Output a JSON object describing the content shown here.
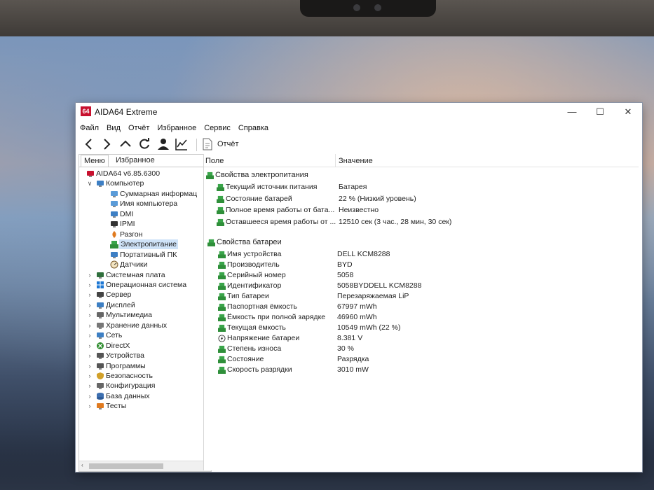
{
  "window": {
    "logo_text": "64",
    "title": "AIDA64 Extreme",
    "minimize": "—",
    "maximize": "☐",
    "close": "✕"
  },
  "menu": [
    "Файл",
    "Вид",
    "Отчёт",
    "Избранное",
    "Сервис",
    "Справка"
  ],
  "toolbar": {
    "icons": [
      "back-icon",
      "forward-icon",
      "up-icon",
      "refresh-icon",
      "user-icon",
      "chart-icon"
    ],
    "report_label": "Отчёт"
  },
  "left_tabs": {
    "menu": "Меню",
    "favorites": "Избранное"
  },
  "tree": [
    {
      "label": "AIDA64 v6.85.6300",
      "level": 0,
      "expander": "",
      "icon": "aida64-icon"
    },
    {
      "label": "Компьютер",
      "level": 1,
      "expander": "∨",
      "icon": "computer-icon"
    },
    {
      "label": "Суммарная информац",
      "level": 2,
      "expander": "",
      "icon": "summary-icon"
    },
    {
      "label": "Имя компьютера",
      "level": 2,
      "expander": "",
      "icon": "computer-name-icon"
    },
    {
      "label": "DMI",
      "level": 2,
      "expander": "",
      "icon": "dmi-icon"
    },
    {
      "label": "IPMI",
      "level": 2,
      "expander": "",
      "icon": "ipmi-icon"
    },
    {
      "label": "Разгон",
      "level": 2,
      "expander": "",
      "icon": "overclock-icon"
    },
    {
      "label": "Электропитание",
      "level": 2,
      "expander": "",
      "icon": "power-icon",
      "selected": true
    },
    {
      "label": "Портативный ПК",
      "level": 2,
      "expander": "",
      "icon": "laptop-icon"
    },
    {
      "label": "Датчики",
      "level": 2,
      "expander": "",
      "icon": "sensor-icon"
    },
    {
      "label": "Системная плата",
      "level": 1,
      "expander": "›",
      "icon": "motherboard-icon"
    },
    {
      "label": "Операционная система",
      "level": 1,
      "expander": "›",
      "icon": "windows-icon"
    },
    {
      "label": "Сервер",
      "level": 1,
      "expander": "›",
      "icon": "server-icon"
    },
    {
      "label": "Дисплей",
      "level": 1,
      "expander": "›",
      "icon": "display-icon"
    },
    {
      "label": "Мультимедиа",
      "level": 1,
      "expander": "›",
      "icon": "multimedia-icon"
    },
    {
      "label": "Хранение данных",
      "level": 1,
      "expander": "›",
      "icon": "storage-icon"
    },
    {
      "label": "Сеть",
      "level": 1,
      "expander": "›",
      "icon": "network-icon"
    },
    {
      "label": "DirectX",
      "level": 1,
      "expander": "›",
      "icon": "directx-icon"
    },
    {
      "label": "Устройства",
      "level": 1,
      "expander": "›",
      "icon": "devices-icon"
    },
    {
      "label": "Программы",
      "level": 1,
      "expander": "›",
      "icon": "programs-icon"
    },
    {
      "label": "Безопасность",
      "level": 1,
      "expander": "›",
      "icon": "security-icon"
    },
    {
      "label": "Конфигурация",
      "level": 1,
      "expander": "›",
      "icon": "config-icon"
    },
    {
      "label": "База данных",
      "level": 1,
      "expander": "›",
      "icon": "database-icon"
    },
    {
      "label": "Тесты",
      "level": 1,
      "expander": "›",
      "icon": "tests-icon"
    }
  ],
  "columns": {
    "field": "Поле",
    "value": "Значение"
  },
  "sections": [
    {
      "title": "Свойства электропитания",
      "rows": [
        {
          "field": "Текущий источник питания",
          "value": "Батарея"
        },
        {
          "field": "Состояние батарей",
          "value": "22 % (Низкий уровень)"
        },
        {
          "field": "Полное время работы от бата...",
          "value": "Неизвестно"
        },
        {
          "field": "Оставшееся время работы от ...",
          "value": "12510 сек (3 час., 28 мин, 30 сек)"
        }
      ]
    },
    {
      "title": "Свойства батареи",
      "rows": [
        {
          "field": "Имя устройства",
          "value": "DELL KCM8288"
        },
        {
          "field": "Производитель",
          "value": "BYD"
        },
        {
          "field": "Серийный номер",
          "value": "5058"
        },
        {
          "field": "Идентификатор",
          "value": "5058BYDDELL KCM8288"
        },
        {
          "field": "Тип батареи",
          "value": "Перезаряжаемая LiP"
        },
        {
          "field": "Паспортная ёмкость",
          "value": "67997 mWh"
        },
        {
          "field": "Ёмкость при полной зарядке",
          "value": "46960 mWh"
        },
        {
          "field": "Текущая ёмкость",
          "value": "10549 mWh  (22 %)"
        },
        {
          "field": "Напряжение батареи",
          "value": "8.381 V",
          "icon": "voltage-icon"
        },
        {
          "field": "Степень износа",
          "value": "30 %"
        },
        {
          "field": "Состояние",
          "value": "Разрядка"
        },
        {
          "field": "Скорость разрядки",
          "value": "3010 mW"
        }
      ]
    }
  ],
  "colors": {
    "accent": "#c8102e",
    "selection": "#cfe3f8",
    "battery_green": "#3aa54a"
  }
}
